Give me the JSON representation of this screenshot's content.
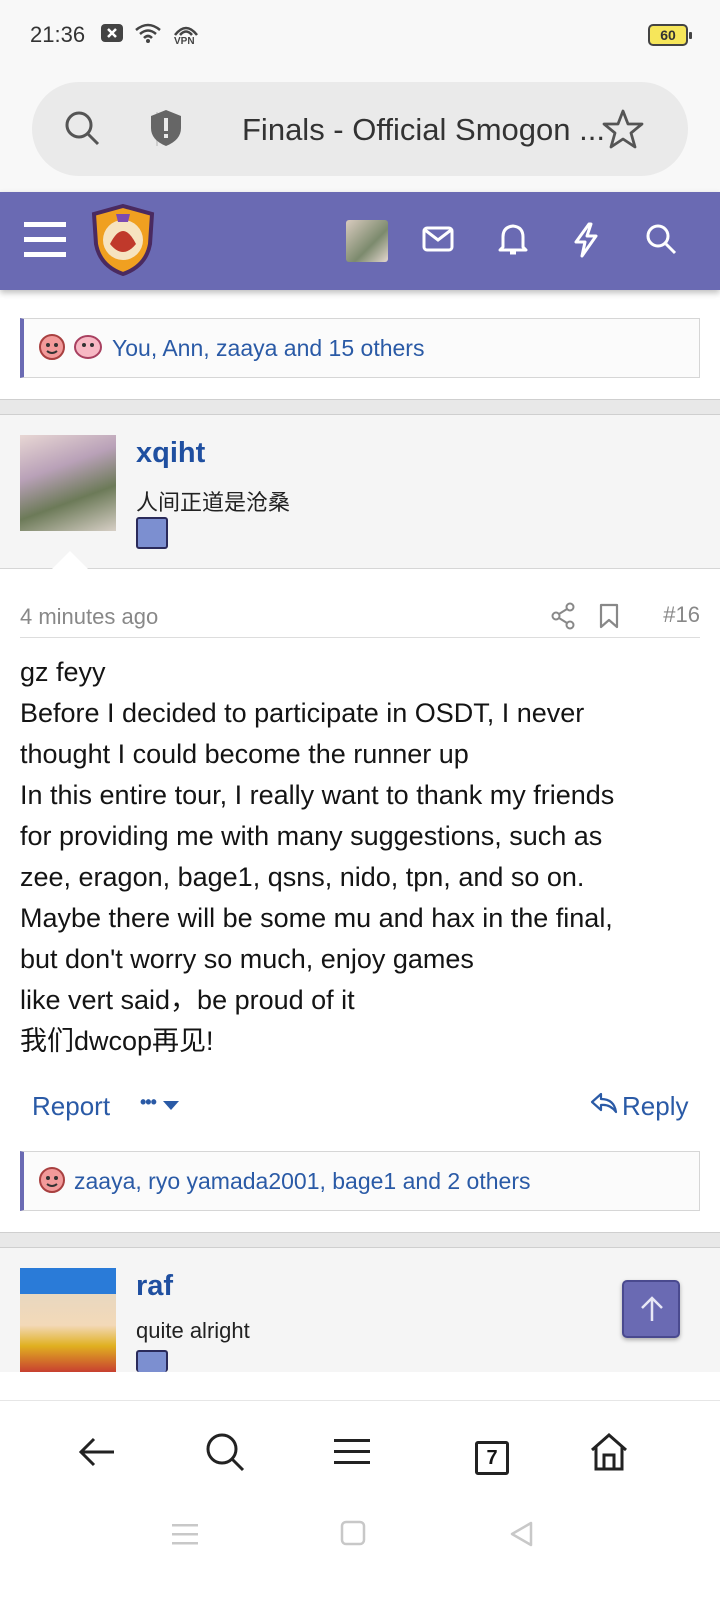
{
  "status_bar": {
    "time": "21:36",
    "battery": "60",
    "vpn_label": "VPN"
  },
  "url_bar": {
    "title": "Finals - Official Smogon ..."
  },
  "reactions_top": {
    "text": "You, Ann, zaaya and 15 others"
  },
  "post": {
    "username": "xqiht",
    "user_title": "人间正道是沧桑",
    "time": "4 minutes ago",
    "number": "#16",
    "body_lines": [
      "gz feyy",
      "Before I decided to participate in OSDT, I never",
      "thought I could become the runner up",
      "In this entire tour, I really want to thank my friends",
      "for providing me with many suggestions, such as",
      "zee, eragon, bage1, qsns, nido, tpn, and so on.",
      "Maybe there will be some mu and hax in the final,",
      "but don't worry so much, enjoy games",
      "like vert said，be proud of it",
      "我们dwcop再见!"
    ],
    "report_label": "Report",
    "more_label": "•••",
    "reply_label": "Reply",
    "reactions": "zaaya, ryo yamada2001, bage1 and 2 others"
  },
  "next_post": {
    "username": "raf",
    "user_title": "quite alright"
  },
  "browser_nav": {
    "tab_count": "7"
  },
  "colors": {
    "header": "#6a6ab3",
    "link": "#2a5aa6",
    "username": "#1f4fa0"
  }
}
